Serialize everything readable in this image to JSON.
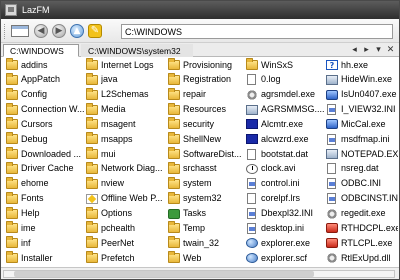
{
  "window": {
    "title": "LazFM"
  },
  "toolbar": {
    "path_value": "C:\\WINDOWS"
  },
  "tabs": [
    {
      "label": "C:\\WINDOWS"
    },
    {
      "label": "C:\\WINDOWS\\system32"
    }
  ],
  "tab_controls": {
    "left": "◂",
    "right": "▸",
    "menu": "▾",
    "close": "✕"
  },
  "columns": [
    {
      "items": [
        {
          "label": "addins",
          "icon": "folder-icon"
        },
        {
          "label": "AppPatch",
          "icon": "folder-icon"
        },
        {
          "label": "Config",
          "icon": "folder-icon"
        },
        {
          "label": "Connection W...",
          "icon": "folder-icon"
        },
        {
          "label": "Cursors",
          "icon": "folder-icon"
        },
        {
          "label": "Debug",
          "icon": "folder-icon"
        },
        {
          "label": "Downloaded ...",
          "icon": "folder-icon"
        },
        {
          "label": "Driver Cache",
          "icon": "folder-icon"
        },
        {
          "label": "ehome",
          "icon": "folder-icon"
        },
        {
          "label": "Fonts",
          "icon": "folder-icon"
        },
        {
          "label": "Help",
          "icon": "folder-icon"
        },
        {
          "label": "ime",
          "icon": "folder-icon"
        },
        {
          "label": "inf",
          "icon": "folder-icon"
        },
        {
          "label": "Installer",
          "icon": "folder-icon"
        }
      ]
    },
    {
      "items": [
        {
          "label": "Internet Logs",
          "icon": "folder-icon"
        },
        {
          "label": "java",
          "icon": "folder-icon"
        },
        {
          "label": "L2Schemas",
          "icon": "folder-icon"
        },
        {
          "label": "Media",
          "icon": "folder-icon"
        },
        {
          "label": "msagent",
          "icon": "folder-icon"
        },
        {
          "label": "msapps",
          "icon": "folder-icon"
        },
        {
          "label": "mui",
          "icon": "folder-icon"
        },
        {
          "label": "Network Diag...",
          "icon": "folder-icon"
        },
        {
          "label": "nview",
          "icon": "folder-icon"
        },
        {
          "label": "Offline Web P...",
          "icon": "offline-web-icon"
        },
        {
          "label": "Options",
          "icon": "folder-icon"
        },
        {
          "label": "pchealth",
          "icon": "folder-icon"
        },
        {
          "label": "PeerNet",
          "icon": "folder-icon"
        },
        {
          "label": "Prefetch",
          "icon": "folder-icon"
        }
      ]
    },
    {
      "items": [
        {
          "label": "Provisioning",
          "icon": "folder-icon"
        },
        {
          "label": "Registration",
          "icon": "folder-icon"
        },
        {
          "label": "repair",
          "icon": "folder-icon"
        },
        {
          "label": "Resources",
          "icon": "folder-icon"
        },
        {
          "label": "security",
          "icon": "folder-icon"
        },
        {
          "label": "ShellNew",
          "icon": "folder-icon"
        },
        {
          "label": "SoftwareDist...",
          "icon": "folder-icon"
        },
        {
          "label": "srchasst",
          "icon": "folder-icon"
        },
        {
          "label": "system",
          "icon": "folder-icon"
        },
        {
          "label": "system32",
          "icon": "folder-icon"
        },
        {
          "label": "Tasks",
          "icon": "tasks-icon"
        },
        {
          "label": "Temp",
          "icon": "folder-icon"
        },
        {
          "label": "twain_32",
          "icon": "folder-icon"
        },
        {
          "label": "Web",
          "icon": "folder-icon"
        }
      ]
    },
    {
      "items": [
        {
          "label": "WinSxS",
          "icon": "folder-icon"
        },
        {
          "label": "0.log",
          "icon": "file-icon"
        },
        {
          "label": "agrsmdel.exe",
          "icon": "gear-icon"
        },
        {
          "label": "AGRSMMSG....",
          "icon": "exe-icon"
        },
        {
          "label": "Alcmtr.exe",
          "icon": "shell-icon"
        },
        {
          "label": "alcwzrd.exe",
          "icon": "shell-icon"
        },
        {
          "label": "bootstat.dat",
          "icon": "file-icon"
        },
        {
          "label": "clock.avi",
          "icon": "clock-icon"
        },
        {
          "label": "control.ini",
          "icon": "ini-icon"
        },
        {
          "label": "corelpf.lrs",
          "icon": "file-icon"
        },
        {
          "label": "Dbexpl32.INI",
          "icon": "ini-icon"
        },
        {
          "label": "desktop.ini",
          "icon": "ini-icon"
        },
        {
          "label": "explorer.exe",
          "icon": "net-icon"
        },
        {
          "label": "explorer.scf",
          "icon": "net-icon"
        }
      ]
    },
    {
      "items": [
        {
          "label": "hh.exe",
          "icon": "help-icon"
        },
        {
          "label": "HideWin.exe",
          "icon": "exe-icon"
        },
        {
          "label": "IsUn0407.exe",
          "icon": "blue-icon"
        },
        {
          "label": "I_VIEW32.INI",
          "icon": "ini-icon"
        },
        {
          "label": "MicCal.exe",
          "icon": "blue-icon"
        },
        {
          "label": "msdfmap.ini",
          "icon": "ini-icon"
        },
        {
          "label": "NOTEPAD.EXE",
          "icon": "exe-icon"
        },
        {
          "label": "nsreg.dat",
          "icon": "file-icon"
        },
        {
          "label": "ODBC.INI",
          "icon": "ini-icon"
        },
        {
          "label": "ODBCINST.INI",
          "icon": "ini-icon"
        },
        {
          "label": "regedit.exe",
          "icon": "gear-icon"
        },
        {
          "label": "RTHDCPL.exe",
          "icon": "red-icon"
        },
        {
          "label": "RTLCPL.exe",
          "icon": "red-icon"
        },
        {
          "label": "RtlExUpd.dll",
          "icon": "gear-icon"
        }
      ]
    }
  ]
}
